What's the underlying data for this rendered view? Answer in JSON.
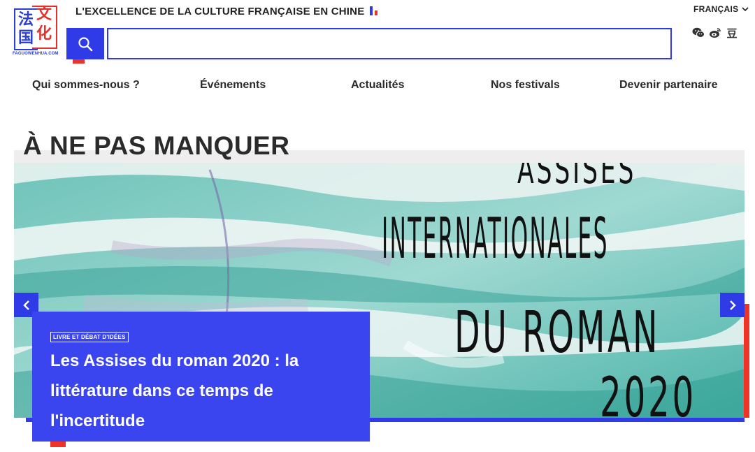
{
  "logo": {
    "chars": [
      "法",
      "文",
      "国",
      "化"
    ],
    "domain": "FAGUOWENHUA.COM"
  },
  "header": {
    "tagline": "L'EXCELLENCE DE LA CULTURE FRANÇAISE EN CHINE",
    "search_placeholder": "",
    "language": "FRANÇAIS",
    "social_icons": [
      "wechat-icon",
      "weibo-icon",
      "douban-icon"
    ],
    "douban_glyph": "豆"
  },
  "nav": {
    "items": [
      {
        "label": "Qui sommes-nous ?"
      },
      {
        "label": "Événements"
      },
      {
        "label": "Actualités"
      },
      {
        "label": "Nos festivals"
      },
      {
        "label": "Devenir partenaire"
      }
    ]
  },
  "section": {
    "title": "À NE PAS MANQUER"
  },
  "hero": {
    "image_text_lines": [
      "ASSISES",
      "INTERNATIONALES",
      "DU ROMAN",
      "2020"
    ],
    "card": {
      "category": "LIVRE ET DÉBAT D'IDÉES",
      "title": "Les Assises du roman 2020 : la littérature dans ce temps de l'incertitude"
    }
  },
  "colors": {
    "blue": "#2f3be6",
    "card_blue": "#3a45f0",
    "red": "#ef3326",
    "text": "#222222"
  }
}
